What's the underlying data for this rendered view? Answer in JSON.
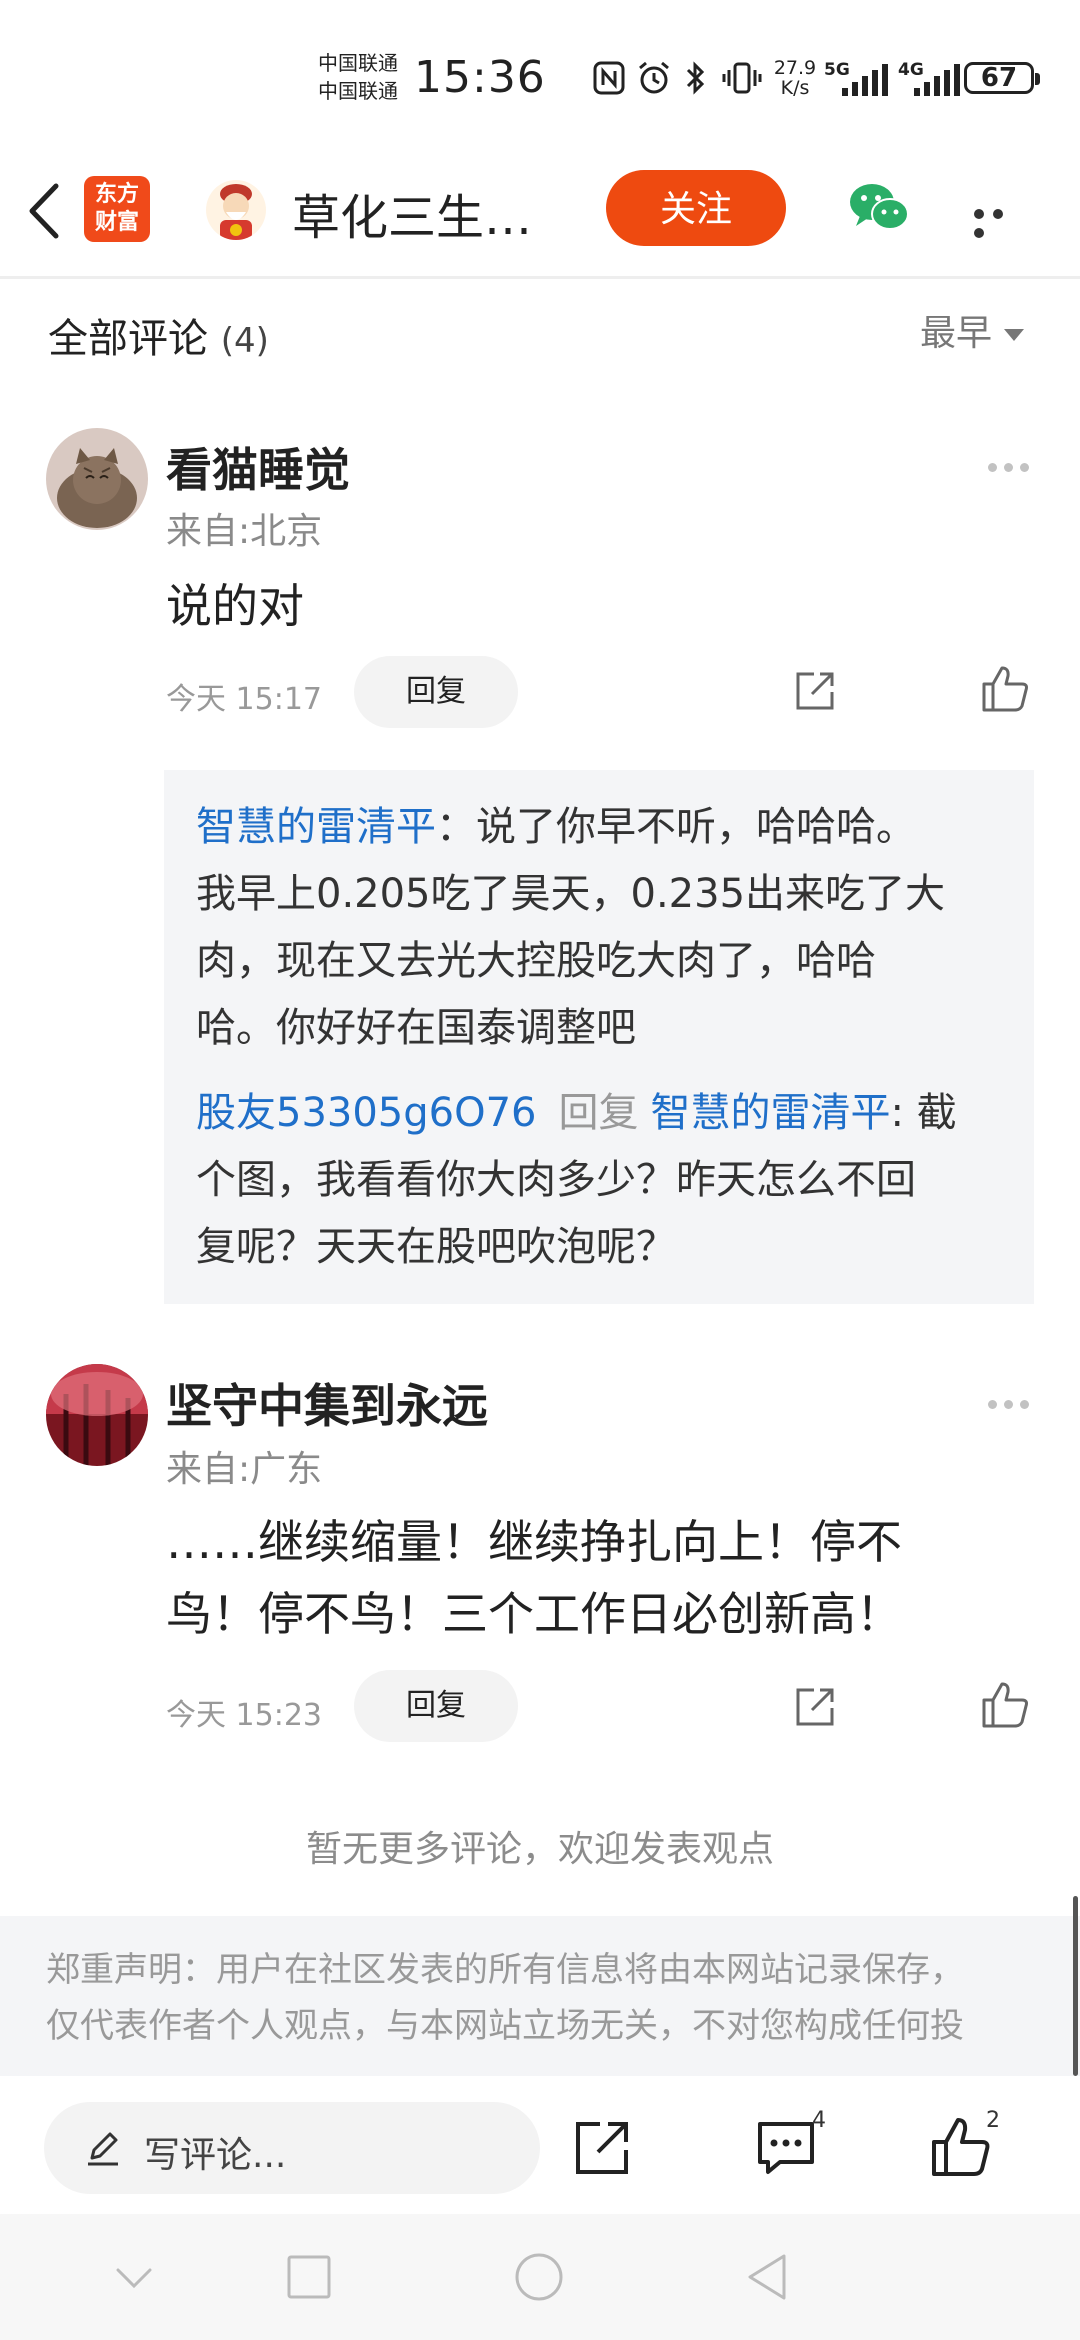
{
  "status_bar": {
    "carrier_1": "中国联通",
    "carrier_2": "中国联通",
    "time": "15:36",
    "net_speed_value": "27.9",
    "net_speed_unit": "K/s",
    "signal_1": "5G",
    "signal_2": "4G",
    "battery": "67"
  },
  "nav": {
    "brand_line1": "东方",
    "brand_line2": "财富",
    "title": "草化三生…",
    "follow_label": "关注"
  },
  "comments_header": {
    "title": "全部评论",
    "count": "(4)",
    "sort_label": "最早"
  },
  "comments": [
    {
      "username": "看猫睡觉",
      "location": "来自:北京",
      "text": "说的对",
      "time": "今天 15:17",
      "reply_label": "回复",
      "replies": [
        {
          "user": "智慧的雷清平",
          "sep": "：",
          "line1": "说了你早不听，哈哈哈。",
          "line2": "我早上0.205吃了昊天，0.235出来吃了大",
          "line3": "肉，现在又去光大控股吃大肉了，哈哈",
          "line4": "哈。你好好在国泰调整吧"
        },
        {
          "user": "股友53305g6O76",
          "reply_word": "回复",
          "target": "智慧的雷清平",
          "sep": ": 截",
          "line2": "个图，我看看你大肉多少？昨天怎么不回",
          "line3": "复呢？天天在股吧吹泡呢？"
        }
      ]
    },
    {
      "username": "坚守中集到永远",
      "location": "来自:广东",
      "line1": "……继续缩量！继续挣扎向上！停不",
      "line2": "鸟！停不鸟！三个工作日必创新高！",
      "time": "今天 15:23",
      "reply_label": "回复"
    }
  ],
  "no_more_text": "暂无更多评论，欢迎发表观点",
  "disclaimer": {
    "line1": "郑重声明：用户在社区发表的所有信息将由本网站记录保存，",
    "line2": "仅代表作者个人观点，与本网站立场无关，不对您构成任何投"
  },
  "bottom_bar": {
    "input_placeholder": "写评论...",
    "comment_count": "4",
    "like_count": "2"
  }
}
